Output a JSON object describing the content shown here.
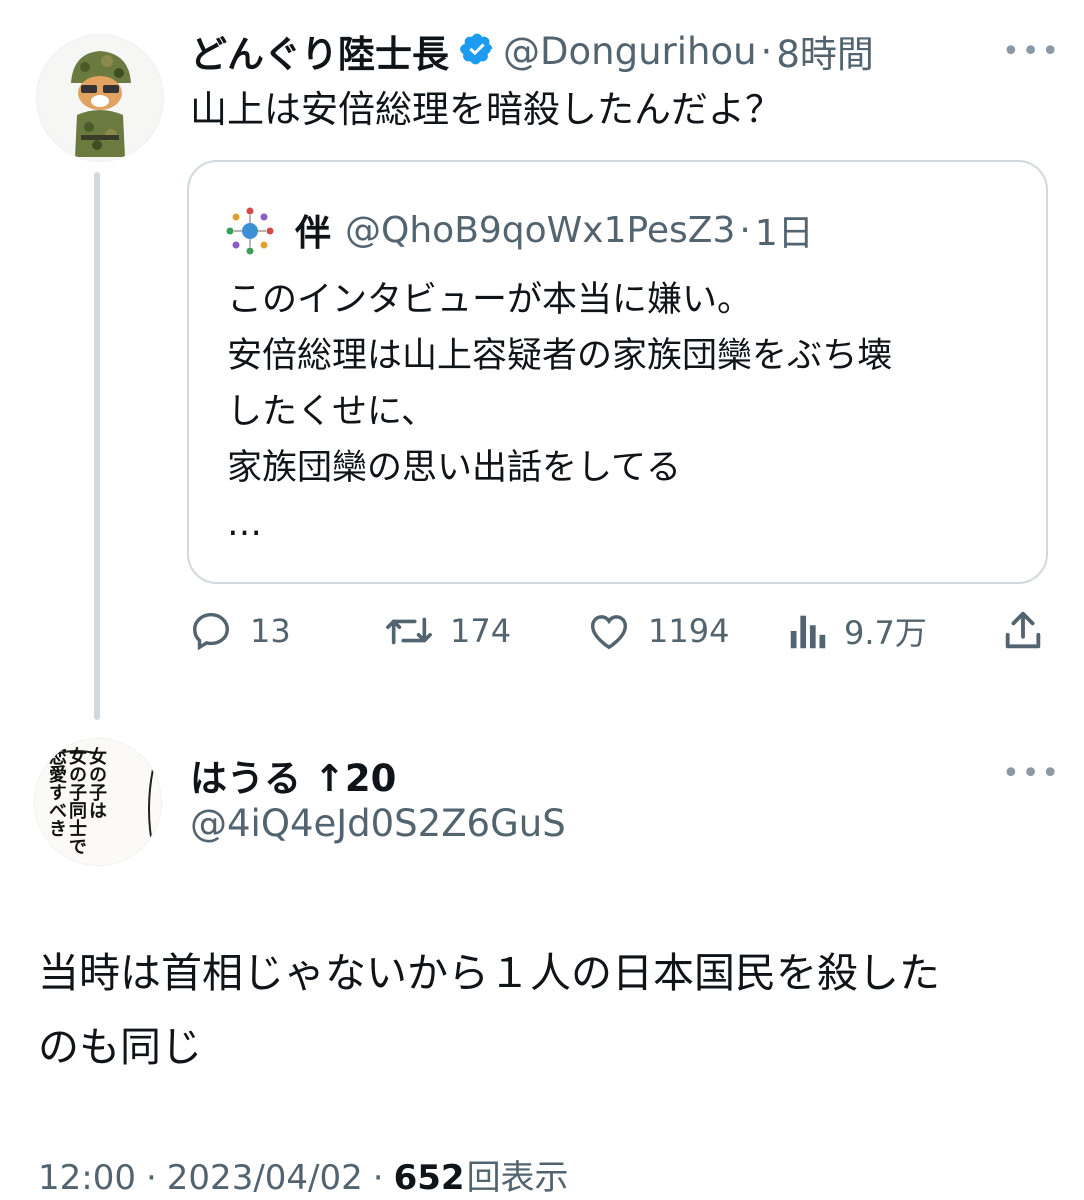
{
  "main_tweet": {
    "display_name": "どんぐり陸士長",
    "handle": "@Dongurihou",
    "separator": "·",
    "time": "8時間",
    "text": "山上は安倍総理を暗殺したんだよ？",
    "more": "•••"
  },
  "quoted_tweet": {
    "display_name": "伴",
    "handle": "@QhoB9qoWx1PesZ3",
    "separator": "·",
    "time": "1日",
    "text": "このインタビューが本当に嫌い。\n安倍総理は山上容疑者の家族団欒をぶち壊\nしたくせに、\n家族団欒の思い出話をしてる\n…"
  },
  "actions": {
    "replies": "13",
    "retweets": "174",
    "likes": "1194",
    "views": "9.7万"
  },
  "reply_tweet": {
    "display_name": "はうる ↑20",
    "handle": "@4iQ4eJd0S2Z6GuS",
    "text_line1": "当時は首相じゃないから１人の日本国民を殺した",
    "text_line2": "のも同じ",
    "more": "•••",
    "avatar_text": [
      "女の子は",
      "女の子同士で",
      "恋愛すべき"
    ]
  },
  "meta": {
    "time": "12:00",
    "sep1": "·",
    "date": "2023/04/02",
    "sep2": "·",
    "views_count": "652",
    "views_label": "回表示"
  },
  "colors": {
    "verified": "#1d9bf0",
    "secondary_text": "#536471",
    "border": "#cfd9de"
  }
}
